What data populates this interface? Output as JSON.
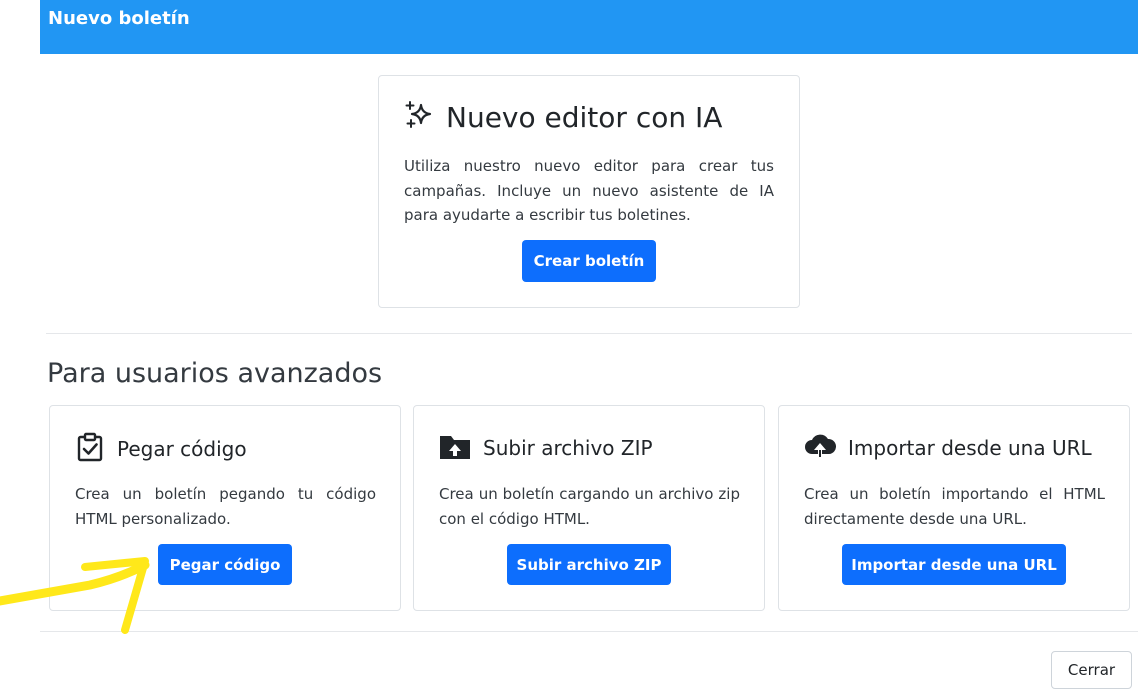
{
  "header": {
    "title": "Nuevo boletín",
    "color": "#2196f3"
  },
  "ai_card": {
    "icon": "sparkles-icon",
    "title": "Nuevo editor con IA",
    "description": "Utiliza nuestro nuevo editor para crear tus campañas. Incluye un nuevo asistente de IA para ayudarte a escribir tus boletines.",
    "button_label": "Crear boletín"
  },
  "advanced": {
    "title": "Para usuarios avanzados",
    "cards": [
      {
        "icon": "clipboard-check-icon",
        "title": "Pegar código",
        "description": "Crea un boletín pegando tu código HTML personalizado.",
        "button_label": "Pegar código"
      },
      {
        "icon": "folder-upload-icon",
        "title": "Subir archivo ZIP",
        "description": "Crea un boletín cargando un archivo zip con el código HTML.",
        "button_label": "Subir archivo ZIP"
      },
      {
        "icon": "cloud-upload-icon",
        "title": "Importar desde una URL",
        "description": "Crea un boletín importando el HTML directamente desde una URL.",
        "button_label": "Importar desde una URL"
      }
    ]
  },
  "footer": {
    "close_label": "Cerrar"
  },
  "colors": {
    "primary_button": "#0d6efd",
    "annotation_arrow": "#ffe81a"
  }
}
